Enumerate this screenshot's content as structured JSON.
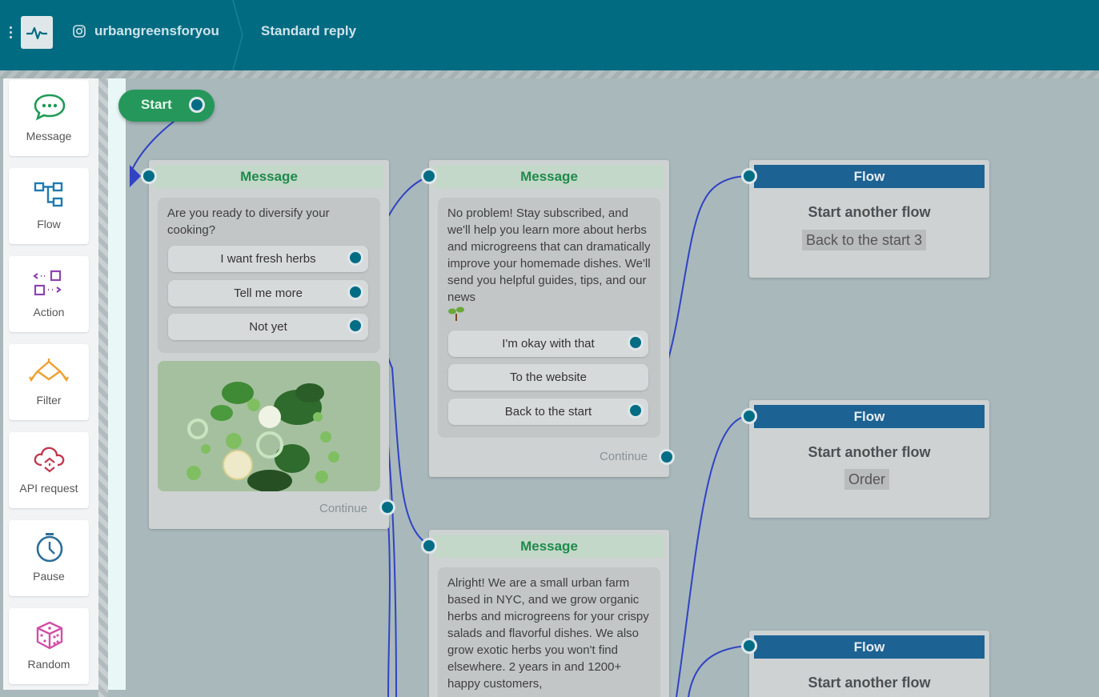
{
  "header": {
    "account": "urbangreensforyou",
    "page_title": "Standard reply"
  },
  "sidebar": {
    "tools": [
      {
        "label": "Message",
        "icon": "message-icon",
        "color": "#1f9a55"
      },
      {
        "label": "Flow",
        "icon": "flow-icon",
        "color": "#1e7ab0"
      },
      {
        "label": "Action",
        "icon": "action-icon",
        "color": "#8e44ad"
      },
      {
        "label": "Filter",
        "icon": "filter-icon",
        "color": "#f0a030"
      },
      {
        "label": "API request",
        "icon": "cloud-api-icon",
        "color": "#c0394e"
      },
      {
        "label": "Pause",
        "icon": "timer-icon",
        "color": "#2b6f9a"
      },
      {
        "label": "Random",
        "icon": "dice-icon",
        "color": "#d24fa6"
      }
    ]
  },
  "canvas": {
    "start_label": "Start",
    "message1": {
      "title": "Message",
      "text": "Are you ready to diversify your cooking?",
      "buttons": [
        "I want fresh herbs",
        "Tell me more",
        "Not yet"
      ],
      "continue": "Continue"
    },
    "message2": {
      "title": "Message",
      "text": "No problem! Stay subscribed, and we'll help you learn more about herbs and microgreens that can dramatically improve your homemade dishes. We'll send you helpful guides, tips, and our news",
      "buttons": [
        "I'm okay with that",
        "To the website",
        "Back to the start"
      ],
      "continue": "Continue"
    },
    "message3": {
      "title": "Message",
      "text": "Alright! We are a small urban farm based in NYC, and we grow organic herbs and microgreens for your crispy salads and flavorful dishes. We also grow exotic herbs you won't find elsewhere. 2 years in and 1200+ happy customers,"
    },
    "flow1": {
      "title": "Flow",
      "text": "Start another flow",
      "tag": "Back to the start 3"
    },
    "flow2": {
      "title": "Flow",
      "text": "Start another flow",
      "tag": "Order"
    },
    "flow3": {
      "title": "Flow",
      "text": "Start another flow"
    }
  },
  "colors": {
    "header_bg": "#016b82",
    "canvas_bg": "#a9b8bb",
    "connector": "#2f43c4",
    "port": "#006d85"
  }
}
